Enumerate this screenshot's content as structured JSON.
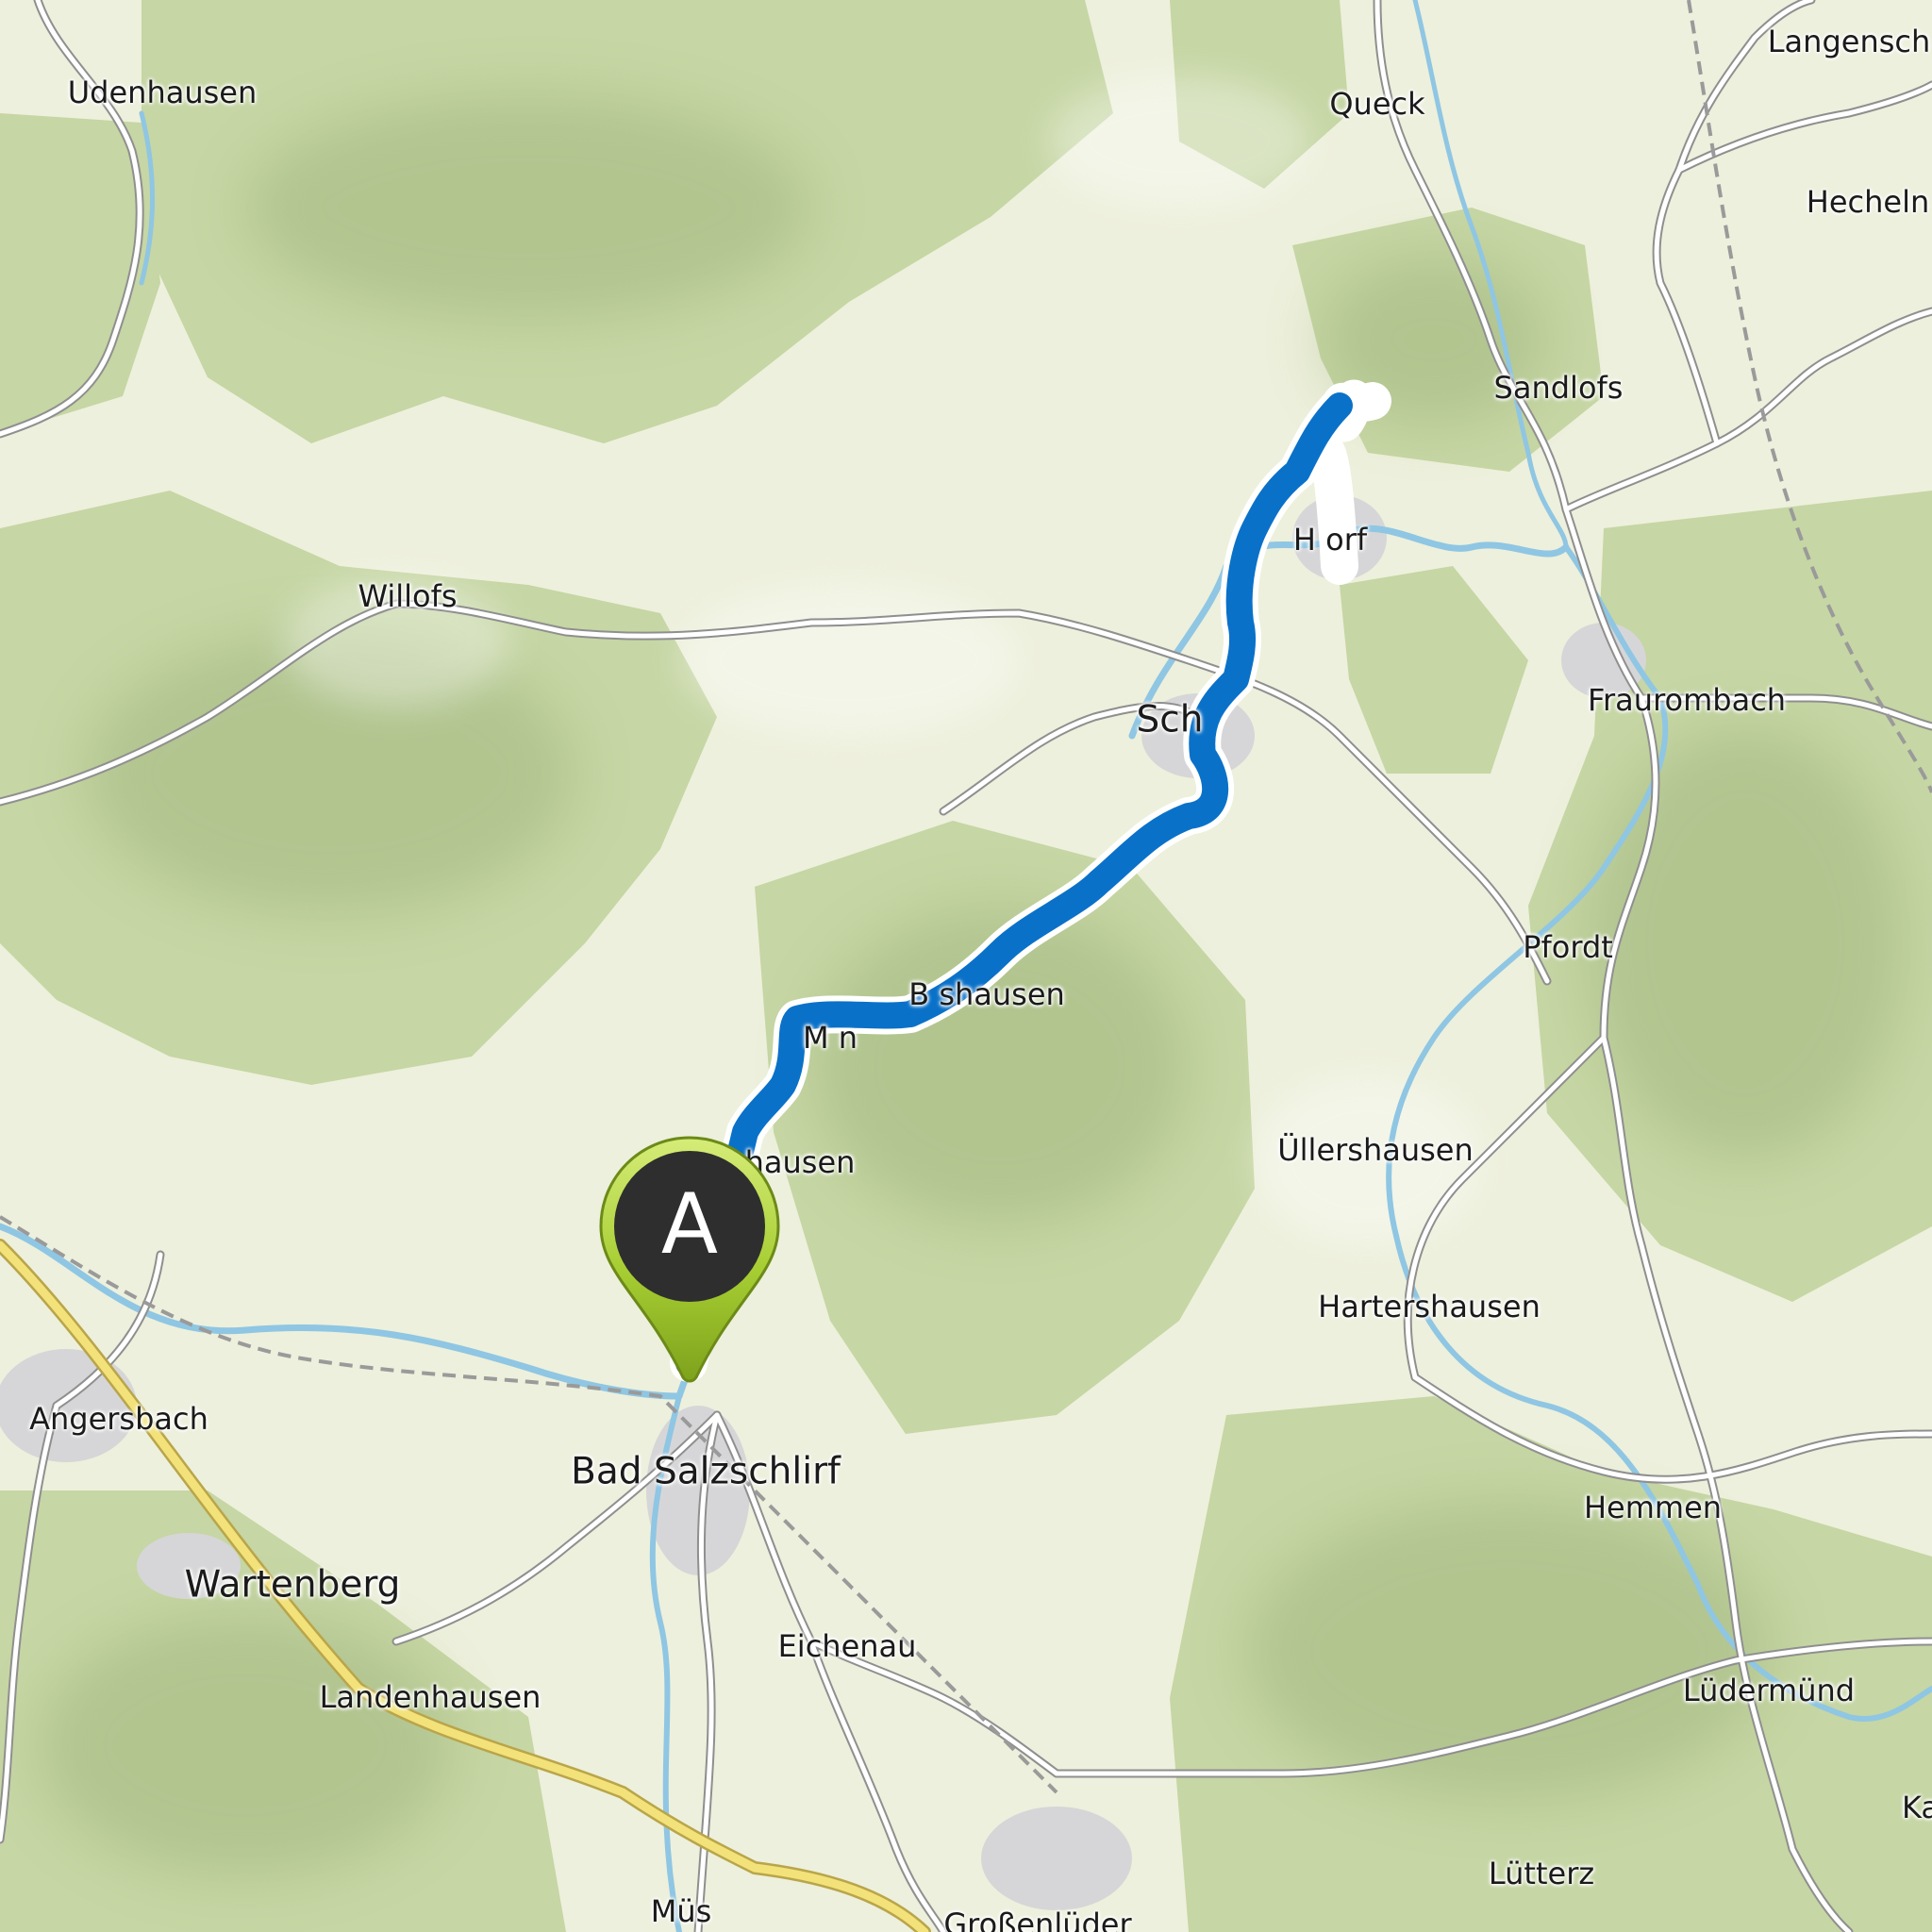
{
  "map": {
    "route_color": "#0a71c9",
    "forest_color": "#c8d7a8",
    "open_land_color": "#ecefd9",
    "river_color": "#8bc7e6",
    "main_road_color": "#f3e27a",
    "places": [
      {
        "id": "udenhausen",
        "name": "Udenhausen",
        "size": "small"
      },
      {
        "id": "queck",
        "name": "Queck",
        "size": "small"
      },
      {
        "id": "langensch",
        "name": "Langensch",
        "size": "small"
      },
      {
        "id": "hecheln",
        "name": "Hecheln",
        "size": "small"
      },
      {
        "id": "sandlofs",
        "name": "Sandlofs",
        "size": "small"
      },
      {
        "id": "willofs",
        "name": "Willofs",
        "size": "small"
      },
      {
        "id": "hainzdorf",
        "name": "H     orf",
        "size": "small"
      },
      {
        "id": "schlitz",
        "name": "Sch",
        "size": "town"
      },
      {
        "id": "fraurombach",
        "name": "Fraurombach",
        "size": "small"
      },
      {
        "id": "pfordt",
        "name": "Pfordt",
        "size": "small"
      },
      {
        "id": "bernshausen",
        "name": "B     shausen",
        "size": "small"
      },
      {
        "id": "michelsrombach",
        "name": "M          n",
        "size": "small"
      },
      {
        "id": "hausen",
        "name": "hausen",
        "size": "small"
      },
      {
        "id": "uellershausen",
        "name": "Üllershausen",
        "size": "small"
      },
      {
        "id": "hartershausen",
        "name": "Hartershausen",
        "size": "small"
      },
      {
        "id": "angersbach",
        "name": "Angersbach",
        "size": "small"
      },
      {
        "id": "bad-salzschlirf",
        "name": "Bad Salzschlirf",
        "size": "town"
      },
      {
        "id": "hemmen",
        "name": "Hemmen",
        "size": "small"
      },
      {
        "id": "wartenberg",
        "name": "Wartenberg",
        "size": "town"
      },
      {
        "id": "eichenau",
        "name": "Eichenau",
        "size": "small"
      },
      {
        "id": "landenhausen",
        "name": "Landenhausen",
        "size": "small"
      },
      {
        "id": "luedermuend",
        "name": "Lüdermünd",
        "size": "small"
      },
      {
        "id": "luetterz",
        "name": "Lütterz",
        "size": "small"
      },
      {
        "id": "mues",
        "name": "Müs",
        "size": "small"
      },
      {
        "id": "grossenlueder",
        "name": "Großenlüder",
        "size": "small"
      },
      {
        "id": "ka",
        "name": "Ka",
        "size": "small"
      }
    ],
    "start_marker": {
      "label": "A",
      "pin_color": "#a6cd32",
      "badge_color": "#2e2e2e"
    }
  }
}
